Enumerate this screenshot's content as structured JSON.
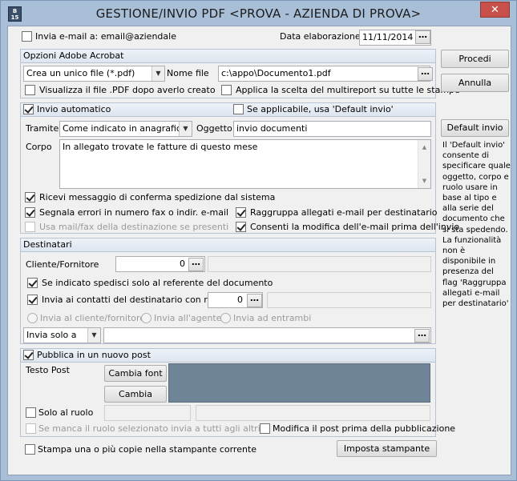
{
  "window": {
    "title": "GESTIONE/INVIO PDF <PROVA - AZIENDA DI PROVA>",
    "icon_text": "B 15",
    "close": "✕"
  },
  "top": {
    "send_email_label": "Invia e-mail a: email@aziendale",
    "date_label": "Data elaborazione",
    "date_value": "11/11/2014"
  },
  "acrobat": {
    "header": "Opzioni Adobe Acrobat",
    "mode_value": "Crea un unico file (*.pdf)",
    "filename_label": "Nome file",
    "filename_value": "c:\\appo\\Documento1.pdf",
    "view_pdf_label": "Visualizza il file .PDF dopo averlo creato",
    "apply_all_label": "Applica la scelta del multireport su tutte le stampe"
  },
  "invio": {
    "header": "Invio automatico",
    "default_label": "Se applicabile, usa 'Default invio'",
    "tramite_label": "Tramite",
    "tramite_value": "Come indicato in anagrafica",
    "oggetto_label": "Oggetto",
    "oggetto_value": "invio documenti",
    "corpo_label": "Corpo",
    "corpo_value": "In allegato trovate le fatture di questo mese",
    "receipt_label": "Ricevi messaggio di conferma spedizione dal sistema",
    "errors_label": "Segnala errori in numero fax o indir. e-mail",
    "group_label": "Raggruppa allegati e-mail per destinatario",
    "usemail_label": "Usa mail/fax della destinazione se presenti",
    "modify_label": "Consenti la modifica dell'e-mail prima dell'invio"
  },
  "destinatari": {
    "header": "Destinatari",
    "cliente_label": "Cliente/Fornitore",
    "cliente_value": "0",
    "referente_label": "Se indicato spedisci solo al referente del documento",
    "contatti_label": "Invia ai contatti del destinatario con ruolo",
    "contatti_value": "0",
    "radio_cliente": "Invia al cliente/fornitore",
    "radio_agente": "Invia all'agente",
    "radio_entrambi": "Invia ad entrambi",
    "invia_solo_value": "Invia solo a"
  },
  "post": {
    "header": "Pubblica in un nuovo post",
    "testo_label": "Testo Post",
    "font_button": "Cambia font",
    "color_button": "Cambia colore",
    "ruolo_label": "Solo al ruolo",
    "manca_label": "Se manca il ruolo selezionato invia a tutti agli altri",
    "modifica_label": "Modifica il post prima della pubblicazione",
    "text_bg": "#6f8496"
  },
  "bottom": {
    "stampa_label": "Stampa una o più copie nella stampante corrente",
    "imposta_button": "Imposta stampante"
  },
  "side": {
    "procedi": "Procedi",
    "annulla": "Annulla",
    "default_invio": "Default invio",
    "help_text": "Il 'Default invio' consente di specificare quale oggetto, corpo e ruolo usare in base al tipo e alla serie del documento che si sta spedendo. La funzionalità non è disponibile in presenza del flag 'Raggruppa allegati e-mail per destinatario'"
  },
  "icons": {
    "close": "close-icon",
    "app": "app-icon",
    "dropdown": "chevron-down-icon",
    "ellipsis": "ellipsis-icon"
  }
}
